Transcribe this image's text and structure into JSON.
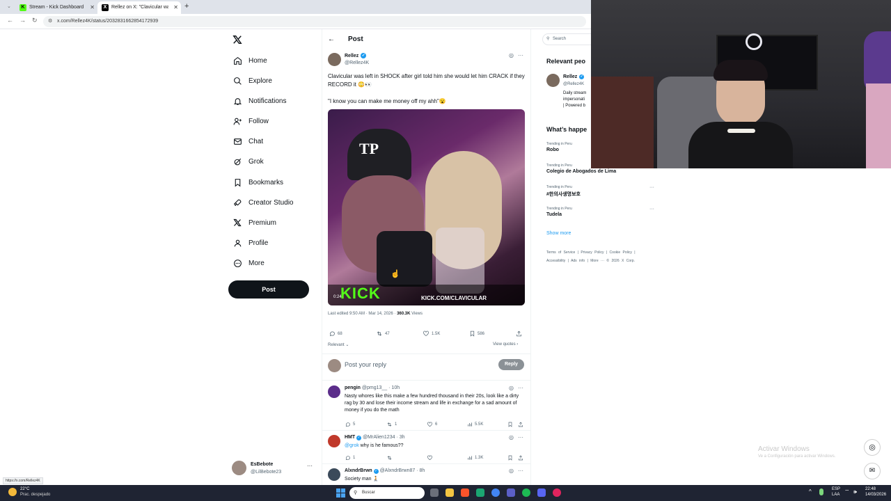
{
  "browser": {
    "tabs": [
      {
        "label": "Stream - Kick Dashboard",
        "favicon": "K"
      },
      {
        "label": "Rellez on X: \"Clavicular was left",
        "favicon": "X"
      }
    ],
    "new_tab": "+",
    "url": "x.com/Rellez4K/status/2032831662854172939",
    "status_link": "https://x.com/Rellez4K"
  },
  "sidebar": {
    "logo": "X",
    "items": [
      {
        "label": "Home",
        "icon": "home-icon"
      },
      {
        "label": "Explore",
        "icon": "search-icon"
      },
      {
        "label": "Notifications",
        "icon": "bell-icon"
      },
      {
        "label": "Follow",
        "icon": "follow-icon"
      },
      {
        "label": "Chat",
        "icon": "mail-icon"
      },
      {
        "label": "Grok",
        "icon": "grok-icon"
      },
      {
        "label": "Bookmarks",
        "icon": "bookmark-icon"
      },
      {
        "label": "Creator Studio",
        "icon": "rocket-icon"
      },
      {
        "label": "Premium",
        "icon": "x-icon"
      },
      {
        "label": "Profile",
        "icon": "person-icon"
      },
      {
        "label": "More",
        "icon": "more-circle-icon"
      }
    ],
    "post_button": "Post",
    "account": {
      "name": "EsBebote",
      "handle": "@LilBebote23",
      "menu": "···"
    }
  },
  "post_header": {
    "back": "←",
    "title": "Post"
  },
  "tweet": {
    "author": "Rellez",
    "handle": "@Rellez4K",
    "menu": "···",
    "text1": "Clavicular was left in SHOCK after girl told him she would let him CRACK if they RECORD it 😳👀",
    "text2": "\"I know you can make me money off my ahh\"😮",
    "video": {
      "time": "0:24",
      "brand": "KICK",
      "url_overlay": "KICK.COM/CLAVICULAR"
    },
    "edited": "Last edited 9:50 AM · Mar 14, 2026 · ",
    "views_count": "360.3K",
    "views_label": " Views",
    "stats": {
      "replies": "68",
      "reposts": "47",
      "likes": "1.5K",
      "bookmarks": "586"
    },
    "sort": "Relevant",
    "view_quotes": "View quotes"
  },
  "composer": {
    "placeholder": "Post your reply",
    "button": "Reply"
  },
  "replies": [
    {
      "name": "pengin",
      "handle": "@pmg13__",
      "time": "· 10h",
      "text": "Nasty whores like this make a few hundred thousand in their 20s, look like a dirty rag by 30 and lose their income stream and life in exchange for a sad amount of money if you do the math",
      "replies": "5",
      "reposts": "1",
      "likes": "6",
      "views": "5.5K",
      "avatar_color": "#5b2d8a"
    },
    {
      "name": "HMT",
      "handle": "@MrAlien1234",
      "time": "· 3h",
      "mention": "@grok",
      "text": " why is he famous??",
      "replies": "1",
      "reposts": "",
      "likes": "",
      "views": "1.3K",
      "avatar_color": "#c0392b"
    },
    {
      "name": "AlxndrBrwn",
      "handle": "@AlxndrBrwn87",
      "time": "· 8h",
      "text": "Society man 🧎",
      "avatar_color": "#3b4a5a"
    }
  ],
  "right": {
    "search_placeholder": "Search",
    "relevant_title": "Relevant peo",
    "relevant_user": {
      "name": "Rellez",
      "handle": "@Rellez4K",
      "bio1": "Daily stream",
      "bio2": "impersonati",
      "bio3": "| Powered b"
    },
    "happening_title": "What’s happe",
    "trends": [
      {
        "context": "Trending in Peru",
        "name": "Robo"
      },
      {
        "context": "Trending in Peru",
        "name": "Colegio de Abogados de Lima"
      },
      {
        "context": "Trending in Peru",
        "name": "#한의사생명보호"
      },
      {
        "context": "Trending in Peru",
        "name": "Tudela"
      }
    ],
    "show_more": "Show more",
    "footer1": [
      "Terms of Service",
      "|",
      "Privacy Policy",
      "|",
      "Cookie Policy",
      "|"
    ],
    "footer2": [
      "Accessibility",
      "|",
      "Ads info",
      "|",
      "More ···",
      "© 2026 X Corp."
    ]
  },
  "activate": {
    "title": "Activar Windows",
    "sub": "Ve a Configuración para activar Windows."
  },
  "taskbar": {
    "weather_temp": "22°C",
    "weather_desc": "Prac. despejado",
    "search": "Buscar",
    "lang1": "ESP",
    "lang2": "LAA",
    "time": "22:48",
    "date": "14/03/2026"
  }
}
